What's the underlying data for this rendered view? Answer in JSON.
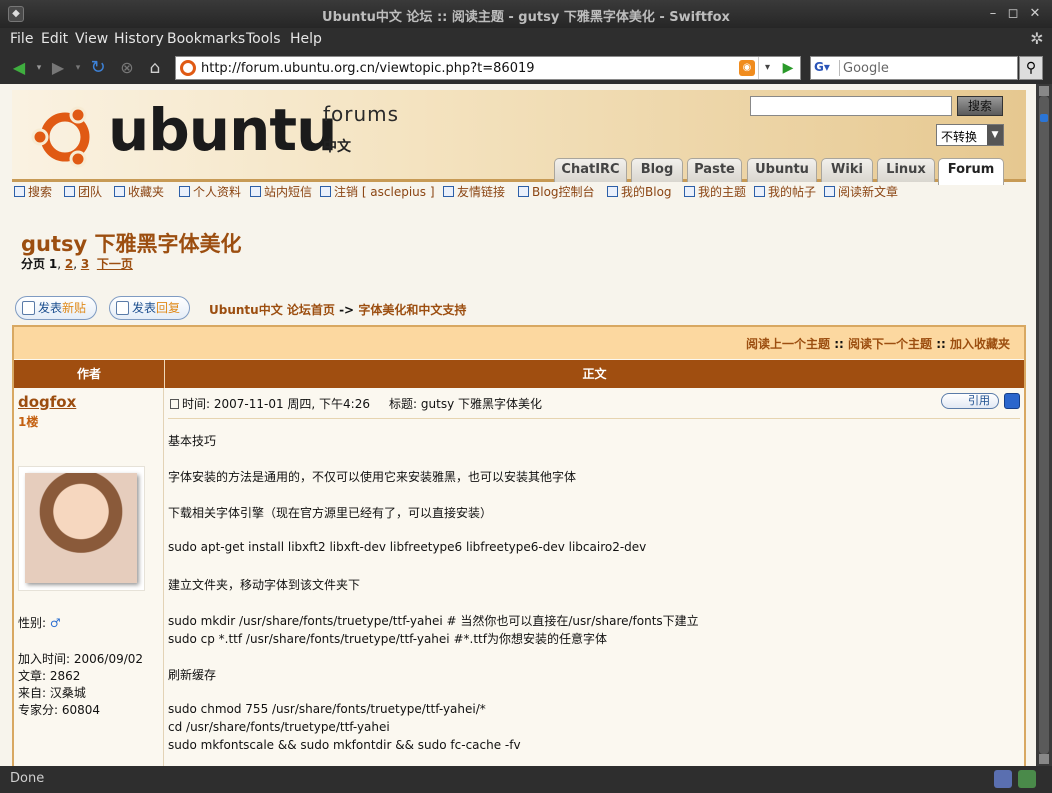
{
  "window": {
    "title": "Ubuntu中文 论坛 :: 阅读主题 - gutsy 下雅黑字体美化 - Swiftfox",
    "controls": [
      "–",
      "◻",
      "✕"
    ]
  },
  "menu": [
    "File",
    "Edit",
    "View",
    "History",
    "Bookmarks",
    "Tools",
    "Help"
  ],
  "nav": {
    "url": "http://forum.ubuntu.org.cn/viewtopic.php?t=86019",
    "search_placeholder": "Google",
    "search_engine_glyph": "G"
  },
  "header": {
    "brand": "ubuntu",
    "forums": "forums",
    "zh": "中文",
    "search_button": "搜索",
    "convert_value": "不转换",
    "tabs": [
      "ChatIRC",
      "Blog",
      "Paste",
      "Ubuntu",
      "Wiki",
      "Linux",
      "Forum"
    ],
    "active_tab": "Forum"
  },
  "quicklinks": [
    "搜索",
    "团队",
    "收藏夹",
    "个人资料",
    "站内短信",
    "注销 [ asclepius ]",
    "友情链接",
    "Blog控制台",
    "我的Blog",
    "我的主题",
    "我的帖子",
    "阅读新文章"
  ],
  "topic": {
    "title": "gutsy 下雅黑字体美化",
    "pages_label": "分页",
    "current_page": "1",
    "page2": "2",
    "page3": "3",
    "next": "下一页",
    "new_post_a": "发表",
    "new_post_b": "新贴",
    "reply_a": "发表",
    "reply_b": "回复",
    "crumb_home": "Ubuntu中文 论坛首页",
    "crumb_sep": "->",
    "crumb_forum": "字体美化和中文支持",
    "prev_topic": "阅读上一个主题",
    "next_topic": "阅读下一个主题",
    "add_fav": "加入收藏夹",
    "sep": "::",
    "col_author": "作者",
    "col_body": "正文"
  },
  "post": {
    "author": "dogfox",
    "floor": "1楼",
    "gender_label": "性别:",
    "gender_symbol": "♂",
    "join": "加入时间: 2006/09/02",
    "posts": "文章: 2862",
    "from": "来自: 汉桑城",
    "expert": "专家分: 60804",
    "meta": "时间: 2007-11-01 周四, 下午4:26     标题: gutsy 下雅黑字体美化",
    "quote": "引用",
    "lines": [
      "基本技巧",
      "字体安装的方法是通用的，不仅可以使用它来安装雅黑，也可以安装其他字体",
      "下载相关字体引擎（现在官方源里已经有了，可以直接安装）",
      "sudo apt-get install libxft2 libxft-dev libfreetype6 libfreetype6-dev libcairo2-dev",
      "建立文件夹，移动字体到该文件夹下",
      "sudo mkdir /usr/share/fonts/truetype/ttf-yahei # 当然你也可以直接在/usr/share/fonts下建立",
      "sudo cp *.ttf /usr/share/fonts/truetype/ttf-yahei #*.ttf为你想安装的任意字体",
      "刷新缓存",
      "sudo chmod 755 /usr/share/fonts/truetype/ttf-yahei/*",
      "cd /usr/share/fonts/truetype/ttf-yahei",
      "sudo mkfontscale && sudo mkfontdir && sudo fc-cache -fv"
    ]
  },
  "status": "Done"
}
